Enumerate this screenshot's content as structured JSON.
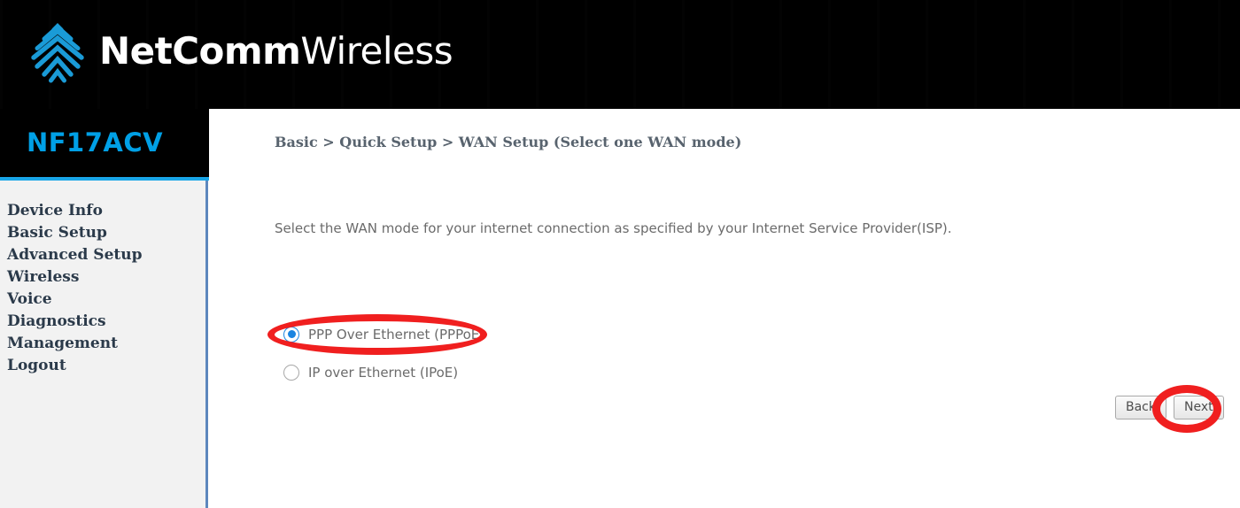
{
  "header": {
    "brand_bold": "NetComm",
    "brand_light": "Wireless",
    "logo_icon": "wifi-signal-logo-icon",
    "background_color": "#000000"
  },
  "sidebar": {
    "model": "NF17ACV",
    "model_color": "#00a0e6",
    "accent_rule_color": "#19a6e8",
    "background_color": "#f2f2f2",
    "border_color": "#5d87bd",
    "items": [
      {
        "label": "Device Info"
      },
      {
        "label": "Basic Setup"
      },
      {
        "label": "Advanced Setup"
      },
      {
        "label": "Wireless"
      },
      {
        "label": "Voice"
      },
      {
        "label": "Diagnostics"
      },
      {
        "label": "Management"
      },
      {
        "label": "Logout"
      }
    ]
  },
  "main": {
    "breadcrumb": "Basic > Quick Setup > WAN Setup (Select one WAN mode)",
    "description": "Select the WAN mode for your internet connection as specified by your Internet Service Provider(ISP).",
    "wan_mode_options": [
      {
        "label": "PPP Over Ethernet (PPPoE)",
        "selected": true
      },
      {
        "label": "IP over Ethernet (IPoE)",
        "selected": false
      }
    ],
    "buttons": {
      "back": "Back",
      "next": "Next"
    }
  },
  "annotations": {
    "color": "#f01f1f",
    "shapes": [
      {
        "name": "pppoe-option-highlight",
        "target": "PPP Over Ethernet (PPPoE)"
      },
      {
        "name": "next-button-highlight",
        "target": "Next"
      }
    ]
  }
}
